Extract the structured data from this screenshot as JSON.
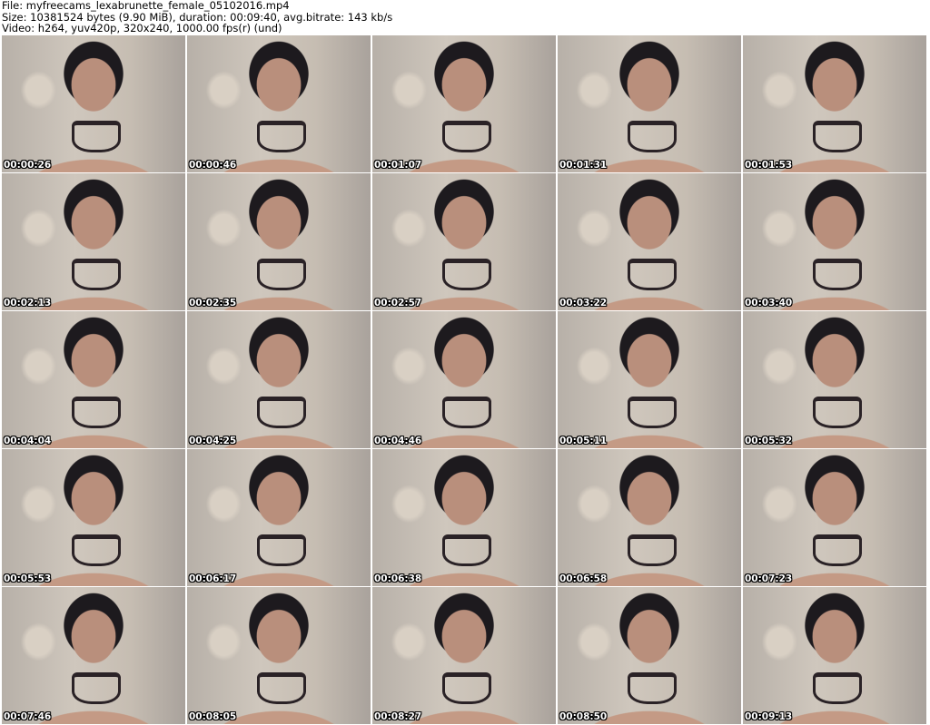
{
  "header": {
    "file_line": "File: myfreecams_lexabrunette_female_05102016.mp4",
    "size_line": "Size: 10381524 bytes (9.90 MiB), duration: 00:09:40, avg.bitrate: 143 kb/s",
    "video_line": "Video: h264, yuv420p, 320x240, 1000.00 fps(r) (und)"
  },
  "thumbnails": [
    "00:00:26",
    "00:00:46",
    "00:01:07",
    "00:01:31",
    "00:01:53",
    "00:02:13",
    "00:02:35",
    "00:02:57",
    "00:03:22",
    "00:03:40",
    "00:04:04",
    "00:04:25",
    "00:04:46",
    "00:05:11",
    "00:05:32",
    "00:05:53",
    "00:06:17",
    "00:06:38",
    "00:06:58",
    "00:07:23",
    "00:07:46",
    "00:08:05",
    "00:08:27",
    "00:08:50",
    "00:09:13"
  ]
}
